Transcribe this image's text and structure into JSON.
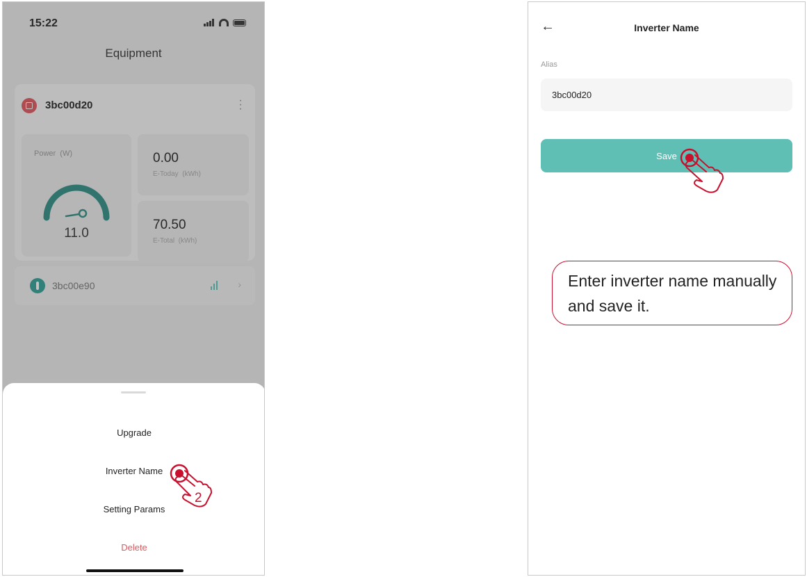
{
  "left_screen": {
    "status": {
      "time": "15:22"
    },
    "title": "Equipment",
    "device": {
      "name": "3bc00d20",
      "power_label": "Power  (W)",
      "power_value": "11.0",
      "today_value": "0.00",
      "today_label": "E-Today  (kWh)",
      "total_value": "70.50",
      "total_label": "E-Total  (kWh)"
    },
    "sub_device": {
      "name": "3bc00e90"
    },
    "sheet": {
      "upgrade": "Upgrade",
      "inverter_name": "Inverter Name",
      "setting_params": "Setting Params",
      "delete": "Delete"
    },
    "step_number": "2"
  },
  "right_screen": {
    "title": "Inverter Name",
    "alias_label": "Alias",
    "alias_value": "3bc00d20",
    "save_label": "Save",
    "note": "Enter inverter name manually and save it."
  },
  "colors": {
    "accent": "#5fbfb4",
    "danger": "#e0565d",
    "annotation": "#c8102e"
  },
  "icons": [
    "back-arrow-icon",
    "kebab-menu-icon",
    "inverter-icon",
    "datalogger-icon",
    "signal-icon",
    "wifi-icon",
    "battery-icon",
    "tap-hand-icon"
  ]
}
